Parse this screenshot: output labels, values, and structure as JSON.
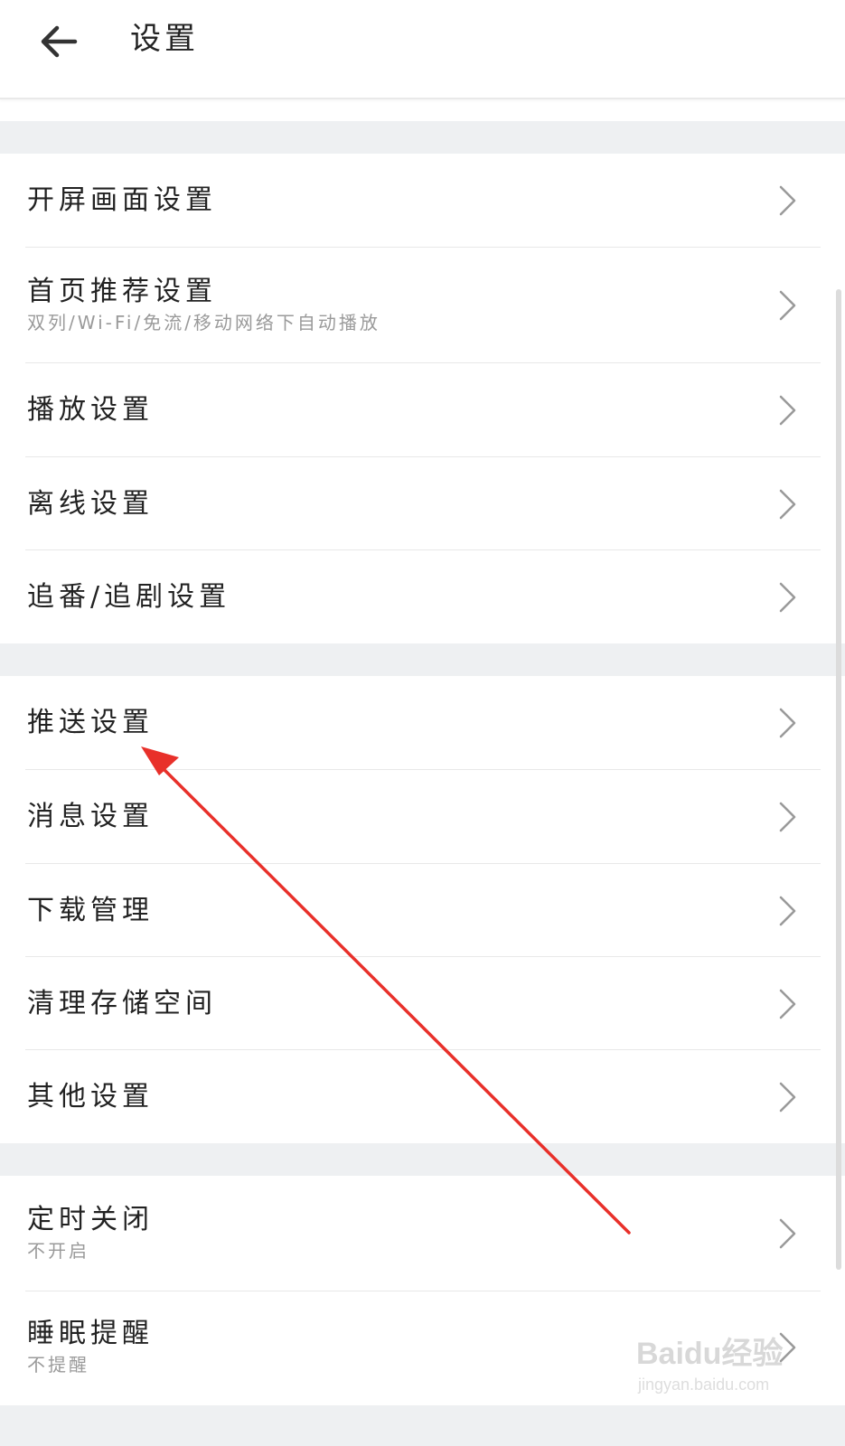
{
  "header": {
    "title": "设置",
    "back_icon": "arrow-left-icon"
  },
  "sections": [
    {
      "items": [
        {
          "label": "开屏画面设置",
          "sub": ""
        },
        {
          "label": "首页推荐设置",
          "sub": "双列/Wi-Fi/免流/移动网络下自动播放"
        },
        {
          "label": "播放设置",
          "sub": ""
        },
        {
          "label": "离线设置",
          "sub": ""
        },
        {
          "label": "追番/追剧设置",
          "sub": ""
        }
      ]
    },
    {
      "items": [
        {
          "label": "推送设置",
          "sub": ""
        },
        {
          "label": "消息设置",
          "sub": ""
        },
        {
          "label": "下载管理",
          "sub": ""
        },
        {
          "label": "清理存储空间",
          "sub": ""
        },
        {
          "label": "其他设置",
          "sub": ""
        }
      ]
    },
    {
      "items": [
        {
          "label": "定时关闭",
          "sub": "不开启"
        },
        {
          "label": "睡眠提醒",
          "sub": "不提醒"
        }
      ]
    }
  ],
  "chevron_icon": "chevron-right-icon",
  "annotation": {
    "arrow_color": "#e8302a"
  },
  "watermark": {
    "brand": "Baidu经验",
    "url": "jingyan.baidu.com"
  },
  "colors": {
    "section_gap": "#eef0f2",
    "divider": "#e8e8e8",
    "subtext": "#9a9a9a"
  }
}
